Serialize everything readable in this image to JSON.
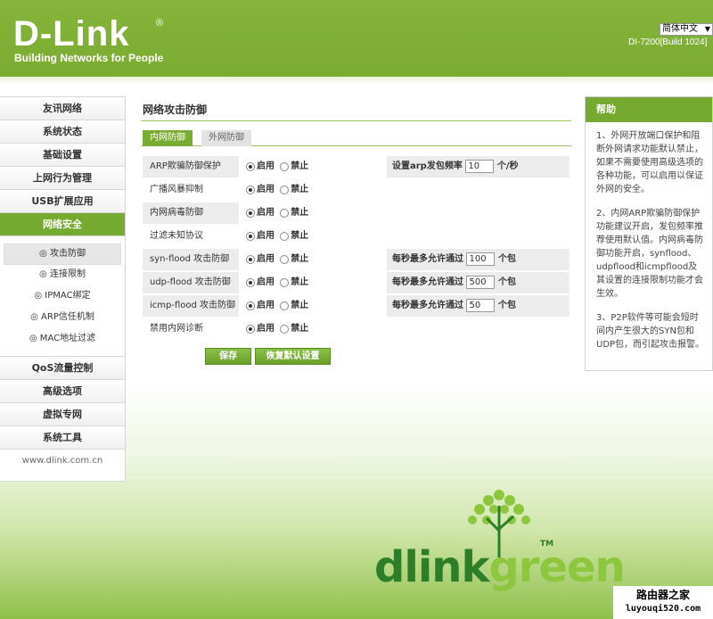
{
  "header": {
    "logo": "D-Link",
    "registered": "®",
    "tagline": "Building Networks for People",
    "language": "简体中文",
    "model": "DI-7200[Build 1024]"
  },
  "nav": {
    "items_top": [
      "友讯网络",
      "系统状态",
      "基础设置",
      "上网行为管理",
      "USB扩展应用"
    ],
    "active": "网络安全",
    "sub_items": [
      "◎ 攻击防御",
      "◎ 连接限制",
      "◎ IPMAC绑定",
      "◎ ARP信任机制",
      "◎ MAC地址过滤"
    ],
    "items_bottom": [
      "QoS流量控制",
      "高级选项",
      "虚拟专网",
      "系统工具"
    ],
    "footer": "www.dlink.com.cn"
  },
  "main": {
    "title": "网络攻击防御",
    "tab_active": "内网防御",
    "tab_inactive": "外网防御",
    "enable": "启用",
    "disable": "禁止",
    "rows": [
      {
        "label": "ARP欺骗防御保护",
        "right_text": "设置arp发包频率",
        "value": "10",
        "suffix": "个/秒"
      },
      {
        "label": "广播风暴抑制"
      },
      {
        "label": "内网病毒防御"
      },
      {
        "label": "过滤未知协议"
      },
      {
        "label": "syn-flood 攻击防御",
        "right_text": "每秒最多允许通过",
        "value": "100",
        "suffix": "个包"
      },
      {
        "label": "udp-flood 攻击防御",
        "right_text": "每秒最多允许通过",
        "value": "500",
        "suffix": "个包"
      },
      {
        "label": "icmp-flood 攻击防御",
        "right_text": "每秒最多允许通过",
        "value": "50",
        "suffix": "个包"
      },
      {
        "label": "禁用内网诊断"
      }
    ],
    "save_label": "保存",
    "reset_label": "恢复默认设置"
  },
  "help": {
    "title": "帮助",
    "paragraphs": [
      "1、外网开放端口保护和阻断外网请求功能默认禁止，如果不需要使用高级选项的各种功能，可以启用以保证外网的安全。",
      "2、内网ARP欺骗防御保护功能建议开启，发包频率推荐使用默认值。内网病毒防御功能开启，synflood、udpflood和icmpflood及其设置的连接限制功能才会生效。",
      "3、P2P软件等可能会短时间内产生很大的SYN包和UDP包，而引起攻击报警。"
    ]
  },
  "footer_logo": {
    "part1": "dlink",
    "part2": "green",
    "tm": "TM"
  },
  "watermark": {
    "line1": "路由器之家",
    "line2": "luyouqi520.com"
  },
  "colors": {
    "brand_green": "#7bab31",
    "dark_green": "#2e7d28",
    "light_green": "#8dc63f"
  }
}
